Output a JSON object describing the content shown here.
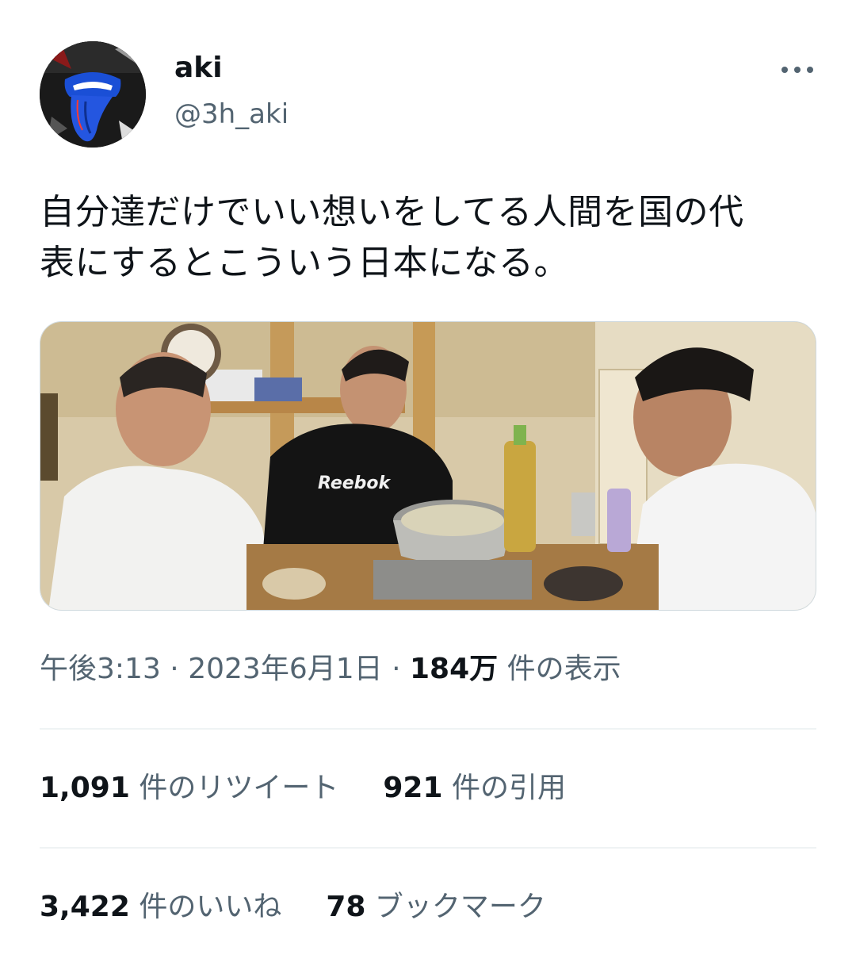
{
  "author": {
    "display_name": "aki",
    "handle": "@3h_aki"
  },
  "tweet": {
    "text_line1": "自分達だけでいい想いをしてる人間を国の代",
    "text_line2": "表にするとこういう日本になる。"
  },
  "meta": {
    "time": "午後3:13",
    "separator1": "·",
    "date": "2023年6月1日",
    "separator2": "·",
    "views_count": "184万",
    "views_label": "件の表示"
  },
  "stats": {
    "retweets_count": "1,091",
    "retweets_label": "件のリツイート",
    "quotes_count": "921",
    "quotes_label": "件の引用",
    "likes_count": "3,422",
    "likes_label": "件のいいね",
    "bookmarks_count": "78",
    "bookmarks_label": "ブックマーク"
  },
  "icons": {
    "avatar": "rolling-stones-tongue-logo",
    "more": "more-options-icon"
  },
  "colors": {
    "text_primary": "#0f1419",
    "text_secondary": "#536471",
    "divider": "#eff3f4"
  }
}
